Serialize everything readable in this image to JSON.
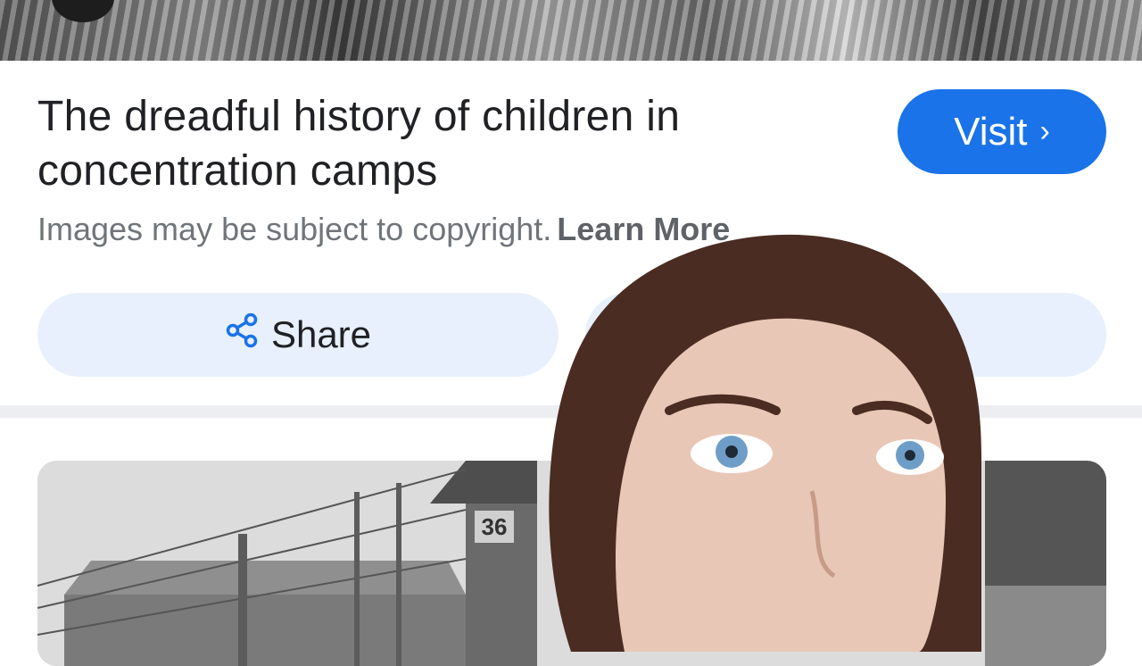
{
  "result": {
    "title": "The dreadful history of children in concentration camps",
    "visit_label": "Visit",
    "visit_icon": "chevron-right-icon",
    "copyright_text": "Images may be subject to copyright.",
    "learn_more_label": "Learn More",
    "share_label": "Share",
    "share_icon": "share-icon"
  },
  "related": {
    "barrack_number": "36"
  },
  "colors": {
    "accent": "#1a73e8",
    "button_bg": "#e8f0fe",
    "title_text": "#202124",
    "secondary_text": "#70757a"
  }
}
